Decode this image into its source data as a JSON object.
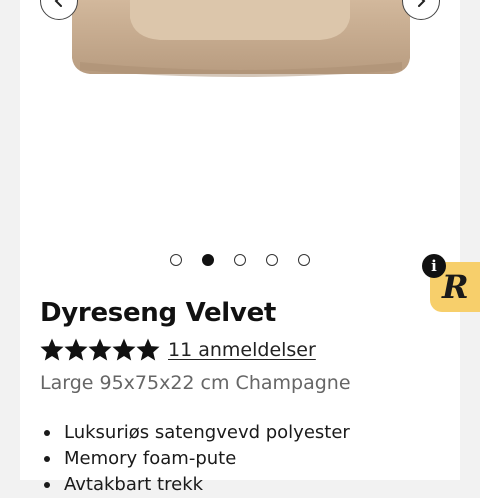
{
  "product": {
    "title": "Dyreseng Velvet",
    "rating": 5,
    "reviews_label": "11 anmeldelser",
    "variant": "Large 95x75x22 cm Champagne",
    "features": [
      "Luksuriøs satengvevd polyester",
      "Memory foam-pute",
      "Avtakbart trekk"
    ]
  },
  "gallery": {
    "slide_count": 5,
    "active_slide": 2,
    "prev_icon": "chevron-left-icon",
    "next_icon": "chevron-right-icon"
  },
  "widget": {
    "logo_text": "R",
    "info_glyph": "i",
    "color": "#f7cf6b"
  },
  "colors": {
    "bed": "#c9ad90",
    "bed_shadow": "#a98e72",
    "cushion": "#d8c1a6"
  }
}
